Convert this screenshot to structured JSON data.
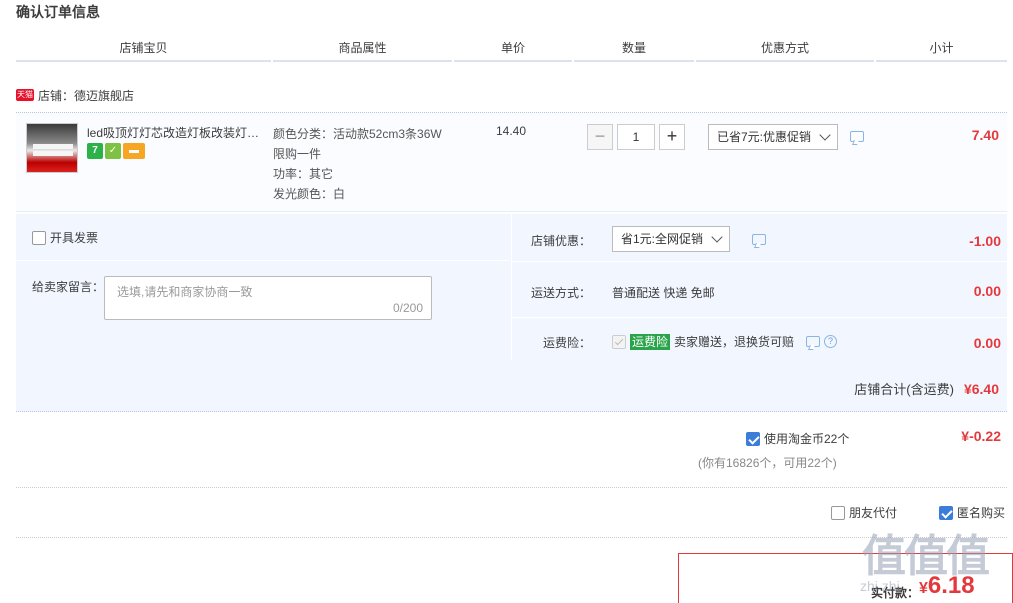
{
  "page_title": "确认订单信息",
  "columns": [
    "店铺宝贝",
    "商品属性",
    "单价",
    "数量",
    "优惠方式",
    "小计"
  ],
  "shop": {
    "badge": "天猫",
    "label": "店铺：德迈旗舰店"
  },
  "item": {
    "title": "led吸顶灯灯芯改造灯板改装灯…",
    "badge_7": "7",
    "props": [
      "颜色分类：活动款52cm3条36W",
      "限购一件",
      "功率：其它",
      "发光颜色：白"
    ],
    "unit_price": "14.40",
    "quantity": "1",
    "qty_minus": "−",
    "qty_plus": "+",
    "discount_option": "已省7元:优惠促销",
    "subtotal": "7.40"
  },
  "invoice": {
    "label": "开具发票"
  },
  "memo": {
    "label": "给卖家留言：",
    "placeholder": "选填,请先和商家协商一致",
    "counter": "0/200"
  },
  "shop_discount": {
    "label": "店铺优惠：",
    "option": "省1元:全网促销",
    "value": "-1.00"
  },
  "shipping": {
    "label": "运送方式：",
    "text": "普通配送 快递 免邮",
    "value": "0.00"
  },
  "insurance": {
    "label": "运费险：",
    "badge": "运费险",
    "text": "卖家赠送，退换货可赔",
    "help": "?",
    "value": "0.00"
  },
  "shop_total": {
    "label": "店铺合计(含运费)",
    "value": "¥6.40"
  },
  "coins": {
    "label": "使用淘金币22个",
    "value": "¥-0.22",
    "note": "(你有16826个，可用22个)"
  },
  "options": {
    "friend_pay": "朋友代付",
    "anonymous": "匿名购买"
  },
  "pay": {
    "label": "实付款：",
    "currency": "¥",
    "value": "6.18"
  },
  "watermark": {
    "main": "值值值",
    "sub": "zhi zhi"
  },
  "colors": {
    "price_red": "#e4393c",
    "panel_blue": "#f2f7ff",
    "check_blue": "#3b7dd8",
    "insurance_green": "#2aa44a"
  }
}
